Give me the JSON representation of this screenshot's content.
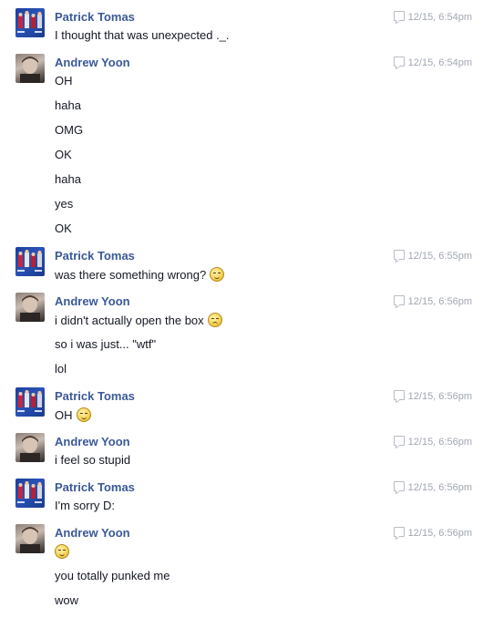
{
  "conversation": [
    {
      "sender": "Patrick Tomas",
      "avatar": "patrick",
      "time": "12/15, 6:54pm",
      "lines": [
        {
          "text": "I thought that was unexpected ._.",
          "emoji": ""
        }
      ]
    },
    {
      "sender": "Andrew Yoon",
      "avatar": "andrew",
      "time": "12/15, 6:54pm",
      "lines": [
        {
          "text": "OH",
          "emoji": ""
        },
        {
          "text": "haha",
          "emoji": ""
        },
        {
          "text": "OMG",
          "emoji": ""
        },
        {
          "text": "OK",
          "emoji": ""
        },
        {
          "text": "haha",
          "emoji": ""
        },
        {
          "text": "yes",
          "emoji": ""
        },
        {
          "text": "OK",
          "emoji": ""
        }
      ]
    },
    {
      "sender": "Patrick Tomas",
      "avatar": "patrick",
      "time": "12/15, 6:55pm",
      "lines": [
        {
          "text": "was there something wrong?",
          "emoji": "squint-smile"
        }
      ]
    },
    {
      "sender": "Andrew Yoon",
      "avatar": "andrew",
      "time": "12/15, 6:56pm",
      "lines": [
        {
          "text": "i didn't actually open the box",
          "emoji": "frown"
        },
        {
          "text": "so i was just... \"wtf\"",
          "emoji": ""
        },
        {
          "text": "lol",
          "emoji": ""
        }
      ]
    },
    {
      "sender": "Patrick Tomas",
      "avatar": "patrick",
      "time": "12/15, 6:56pm",
      "lines": [
        {
          "text": "OH",
          "emoji": "squint-smile"
        }
      ]
    },
    {
      "sender": "Andrew Yoon",
      "avatar": "andrew",
      "time": "12/15, 6:56pm",
      "lines": [
        {
          "text": "i feel so stupid",
          "emoji": ""
        }
      ]
    },
    {
      "sender": "Patrick Tomas",
      "avatar": "patrick",
      "time": "12/15, 6:56pm",
      "lines": [
        {
          "text": "I'm sorry D:",
          "emoji": ""
        }
      ]
    },
    {
      "sender": "Andrew Yoon",
      "avatar": "andrew",
      "time": "12/15, 6:56pm",
      "lines": [
        {
          "text": "",
          "emoji": "unamused"
        },
        {
          "text": "you totally punked me",
          "emoji": ""
        },
        {
          "text": "wow",
          "emoji": ""
        }
      ]
    }
  ],
  "colors": {
    "name": "#3b5998",
    "timestamp": "#a0a6b1",
    "text": "#141823"
  }
}
